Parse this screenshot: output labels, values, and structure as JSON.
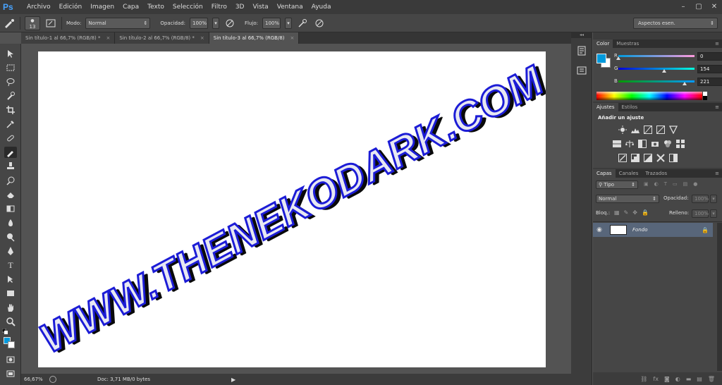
{
  "app": {
    "logo": "Ps"
  },
  "menu": [
    "Archivo",
    "Edición",
    "Imagen",
    "Capa",
    "Texto",
    "Selección",
    "Filtro",
    "3D",
    "Vista",
    "Ventana",
    "Ayuda"
  ],
  "window_controls": {
    "minimize": "–",
    "restore": "▢",
    "close": "✕"
  },
  "options": {
    "brush_size": "13",
    "mode_label": "Modo:",
    "mode_value": "Normal",
    "opacity_label": "Opacidad:",
    "opacity_value": "100%",
    "flow_label": "Flujo:",
    "flow_value": "100%",
    "workspace": "Aspectos esen."
  },
  "tabs": [
    {
      "label": "Sin título-1 al 66,7% (RGB/8) *",
      "close": "×"
    },
    {
      "label": "Sin título-2 al 66,7% (RGB/8) *",
      "close": "×"
    },
    {
      "label": "Sin título-3 al 66,7% (RGB/8)",
      "close": "×"
    }
  ],
  "canvas": {
    "text": "WWW.THENEKODARK.COM"
  },
  "status": {
    "zoom": "66,67%",
    "doc": "Doc: 3,71 MB/0 bytes"
  },
  "color_panel": {
    "tabs": [
      "Color",
      "Muestras"
    ],
    "r_label": "R",
    "r": "0",
    "g_label": "G",
    "g": "154",
    "b_label": "B",
    "b": "221",
    "r_fraction": 0.0,
    "g_fraction": 0.604,
    "b_fraction": 0.867,
    "foreground": "#009add",
    "background": "#ffffff"
  },
  "adjustments": {
    "tabs": [
      "Ajustes",
      "Estilos"
    ],
    "title": "Añadir un ajuste"
  },
  "layers": {
    "tabs": [
      "Capas",
      "Canales",
      "Trazados"
    ],
    "filter": "Tipo",
    "blend": "Normal",
    "opacity_label": "Opacidad:",
    "opacity_value": "100%",
    "lock_label": "Bloq.:",
    "fill_label": "Relleno:",
    "fill_value": "100%",
    "layer_name": "Fondo"
  },
  "colors": {
    "accent": "#009add",
    "canvas_text_stroke": "#1c1cd6",
    "layer_selected": "#58667a"
  }
}
